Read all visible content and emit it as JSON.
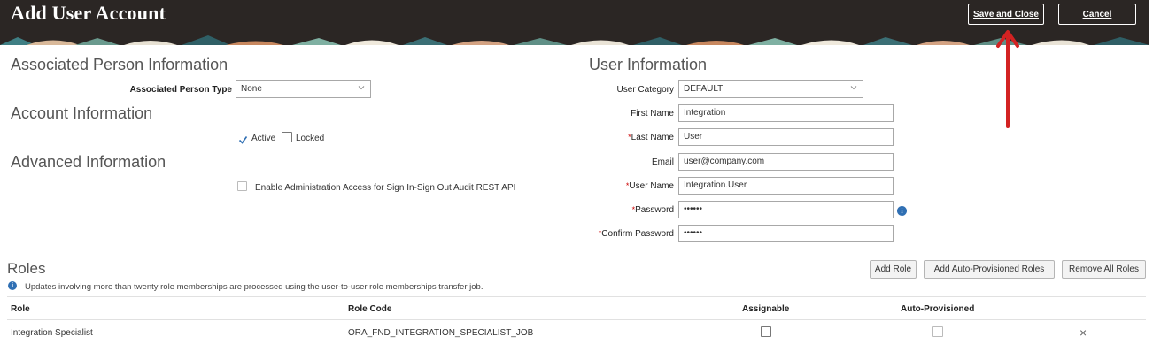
{
  "header": {
    "title": "Add User Account",
    "save_label": "Save and Close",
    "cancel_label": "Cancel"
  },
  "associated_person": {
    "section_title": "Associated Person Information",
    "type_label": "Associated Person Type",
    "type_value": "None"
  },
  "account": {
    "section_title": "Account Information",
    "active_label": "Active",
    "active_checked": true,
    "locked_label": "Locked",
    "locked_checked": false
  },
  "advanced": {
    "section_title": "Advanced Information",
    "admin_access_label": "Enable Administration Access for Sign In-Sign Out Audit REST API",
    "admin_access_checked": false
  },
  "user_info": {
    "section_title": "User Information",
    "category_label": "User Category",
    "category_value": "DEFAULT",
    "first_name_label": "First Name",
    "first_name_value": "Integration",
    "last_name_label": "Last Name",
    "last_name_value": "User",
    "email_label": "Email",
    "email_value": "user@company.com",
    "username_label": "User Name",
    "username_value": "Integration.User",
    "password_label": "Password",
    "password_value": "••••••",
    "confirm_password_label": "Confirm Password",
    "confirm_password_value": "••••••",
    "required_marker": "*"
  },
  "roles": {
    "section_title": "Roles",
    "info_text": "Updates involving more than twenty role memberships are processed using the user-to-user role memberships transfer job.",
    "add_role_label": "Add Role",
    "add_auto_label": "Add Auto-Provisioned Roles",
    "remove_all_label": "Remove All Roles",
    "columns": [
      "Role",
      "Role Code",
      "Assignable",
      "Auto-Provisioned"
    ],
    "rows": [
      {
        "role": "Integration Specialist",
        "role_code": "ORA_FND_INTEGRATION_SPECIALIST_JOB",
        "assignable": false,
        "auto_provisioned": false
      }
    ],
    "remove_icon": "×"
  },
  "colors": {
    "header_bg": "#2b2624",
    "annotation_arrow": "#d32222",
    "info_icon": "#2f6fb3"
  }
}
